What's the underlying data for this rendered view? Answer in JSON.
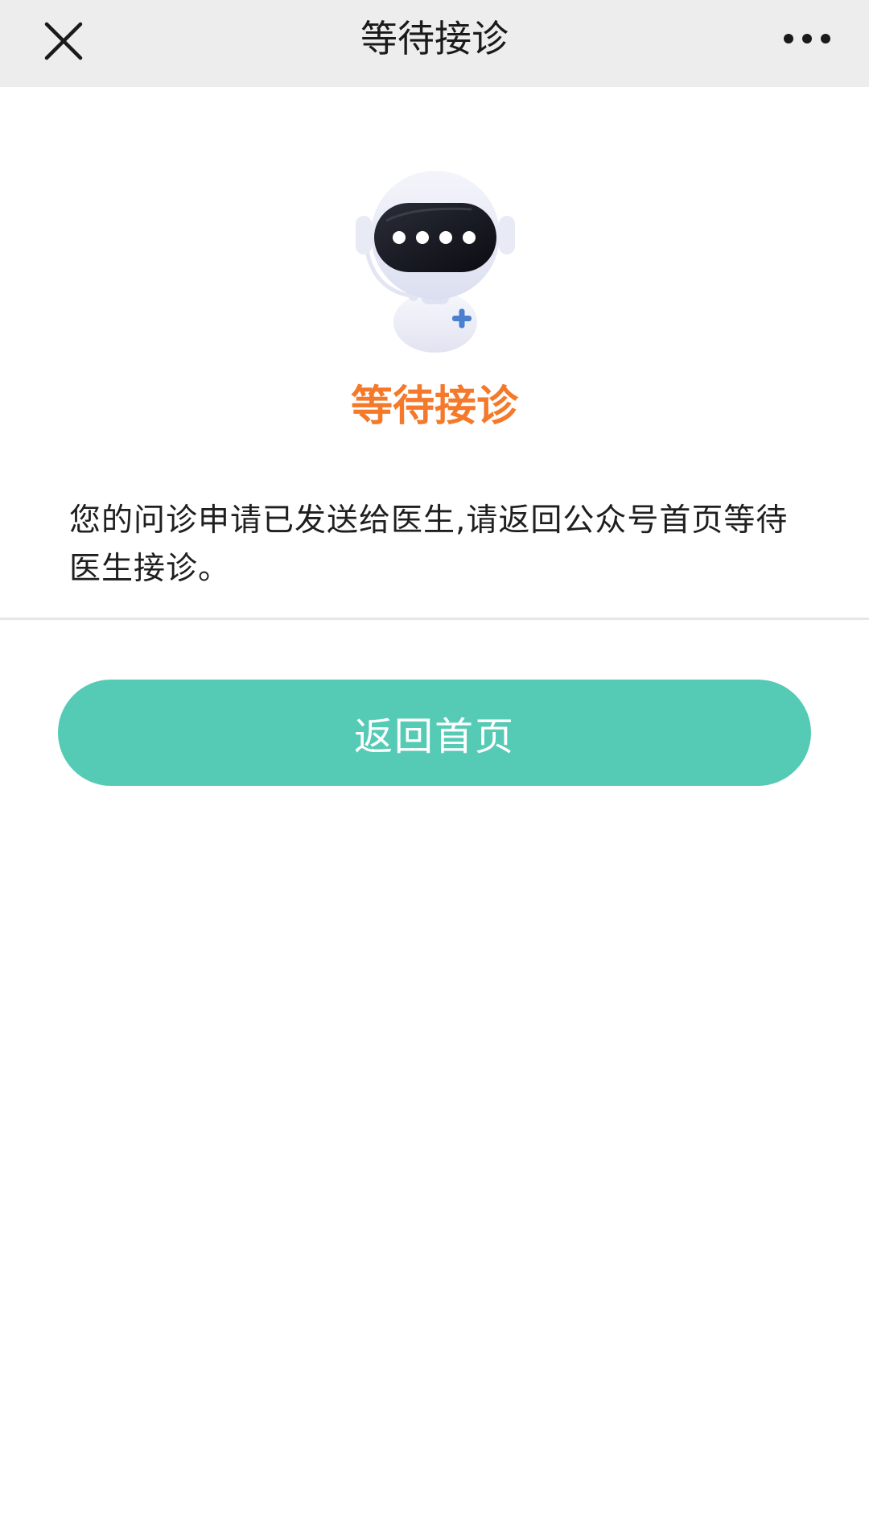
{
  "navbar": {
    "title": "等待接诊",
    "close_icon": "close-icon",
    "more_icon": "more-options-icon"
  },
  "illustration": {
    "icon": "doctor-robot-icon"
  },
  "status": {
    "title": "等待接诊",
    "color": "#f5792a"
  },
  "message": {
    "text": "您的问诊申请已发送给医生,请返回公众号首页等待医生接诊。"
  },
  "actions": {
    "home_button_label": "返回首页",
    "button_color": "#55cab4"
  }
}
